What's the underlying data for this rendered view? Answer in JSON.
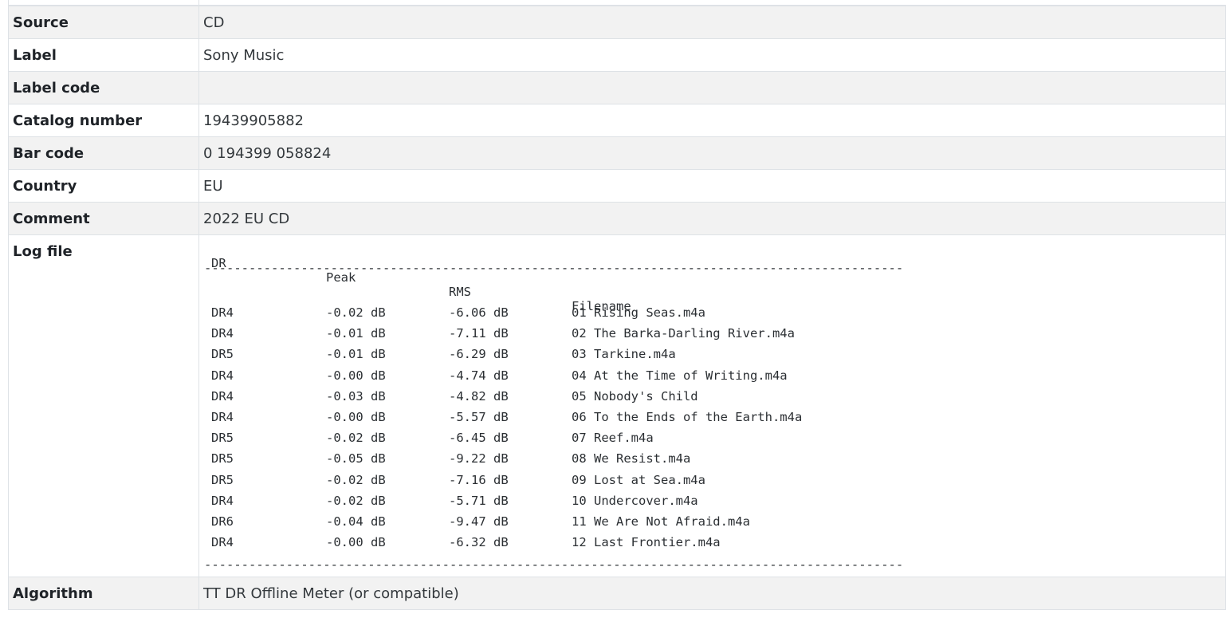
{
  "fields": [
    {
      "key": "Source",
      "value": "CD"
    },
    {
      "key": "Label",
      "value": "Sony Music"
    },
    {
      "key": "Label code",
      "value": ""
    },
    {
      "key": "Catalog number",
      "value": "19439905882"
    },
    {
      "key": "Bar code",
      "value": "0 194399 058824"
    },
    {
      "key": "Country",
      "value": "EU"
    },
    {
      "key": "Comment",
      "value": "2022 EU CD"
    }
  ],
  "log": {
    "key": "Log file",
    "headers": {
      "dr": "DR",
      "peak": "Peak",
      "rms": "RMS",
      "filename": "Filename"
    },
    "separator": "----------------------------------------------------------------------------------------------",
    "rows": [
      {
        "dr": "DR4",
        "peak": "-0.02 dB",
        "rms": "-6.06 dB",
        "filename": "01 Rising Seas.m4a"
      },
      {
        "dr": "DR4",
        "peak": "-0.01 dB",
        "rms": "-7.11 dB",
        "filename": "02 The Barka-Darling River.m4a"
      },
      {
        "dr": "DR5",
        "peak": "-0.01 dB",
        "rms": "-6.29 dB",
        "filename": "03 Tarkine.m4a"
      },
      {
        "dr": "DR4",
        "peak": "-0.00 dB",
        "rms": "-4.74 dB",
        "filename": "04 At the Time of Writing.m4a"
      },
      {
        "dr": "DR4",
        "peak": "-0.03 dB",
        "rms": "-4.82 dB",
        "filename": "05 Nobody's Child"
      },
      {
        "dr": "DR4",
        "peak": "-0.00 dB",
        "rms": "-5.57 dB",
        "filename": "06 To the Ends of the Earth.m4a"
      },
      {
        "dr": "DR5",
        "peak": "-0.02 dB",
        "rms": "-6.45 dB",
        "filename": "07 Reef.m4a"
      },
      {
        "dr": "DR5",
        "peak": "-0.05 dB",
        "rms": "-9.22 dB",
        "filename": "08 We Resist.m4a"
      },
      {
        "dr": "DR5",
        "peak": "-0.02 dB",
        "rms": "-7.16 dB",
        "filename": "09 Lost at Sea.m4a"
      },
      {
        "dr": "DR4",
        "peak": "-0.02 dB",
        "rms": "-5.71 dB",
        "filename": "10 Undercover.m4a"
      },
      {
        "dr": "DR6",
        "peak": "-0.04 dB",
        "rms": "-9.47 dB",
        "filename": "11 We Are Not Afraid.m4a"
      },
      {
        "dr": "DR4",
        "peak": "-0.00 dB",
        "rms": "-6.32 dB",
        "filename": "12 Last Frontier.m4a"
      }
    ]
  },
  "algorithm": {
    "key": "Algorithm",
    "value": "TT DR Offline Meter (or compatible)"
  }
}
